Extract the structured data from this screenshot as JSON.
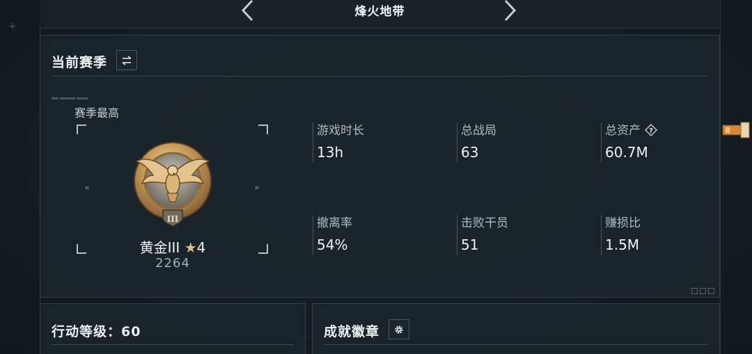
{
  "header": {
    "title": "烽火地带"
  },
  "season_panel": {
    "title": "当前赛季",
    "caption": "赛季最高",
    "rank": {
      "tier": "黄金III",
      "stars": "4",
      "score": "2264"
    },
    "stats": [
      {
        "label": "游戏时长",
        "value": "13h"
      },
      {
        "label": "总战局",
        "value": "63"
      },
      {
        "label": "总资产",
        "value": "60.7M",
        "help": true
      },
      {
        "label": "撤离率",
        "value": "54%"
      },
      {
        "label": "击败干员",
        "value": "51"
      },
      {
        "label": "赚损比",
        "value": "1.5M"
      }
    ]
  },
  "level_panel": {
    "label": "行动等级：",
    "value": "60"
  },
  "badge_panel": {
    "title": "成就徽章"
  },
  "colors": {
    "background": "#151c22",
    "panel": "#1b242a",
    "border": "#344047",
    "accent_gold": "#c9a463",
    "text": "#e6eaec"
  },
  "icons": [
    "chevron-left-icon",
    "chevron-right-icon",
    "swap-icon",
    "question-icon",
    "gear-icon",
    "gold-rank-emblem",
    "star-icon"
  ]
}
